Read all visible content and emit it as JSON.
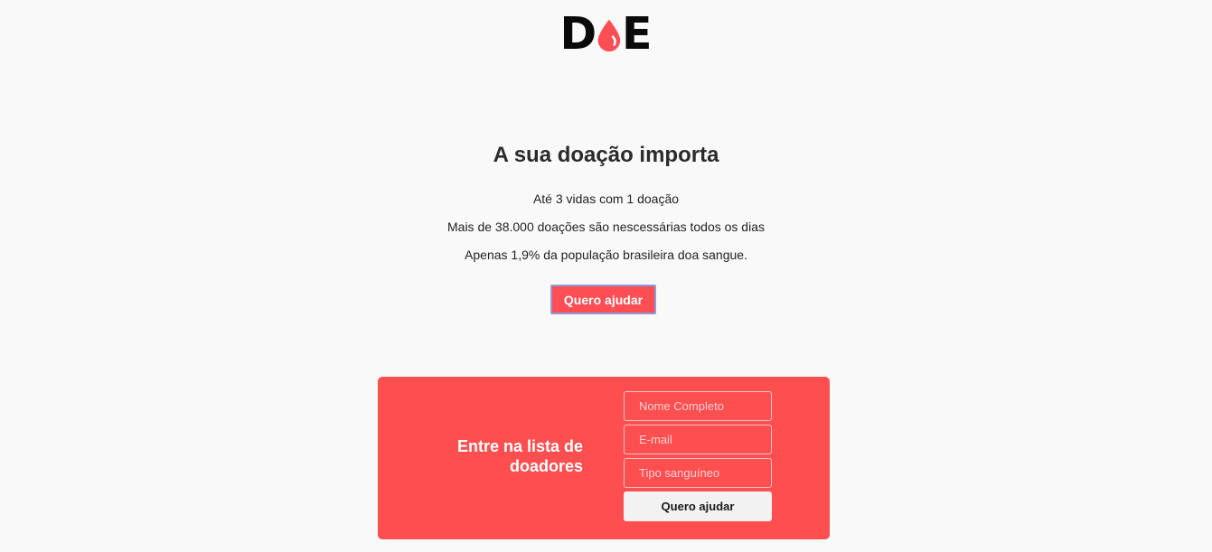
{
  "logo": {
    "letter_left": "D",
    "letter_right": "E",
    "drop_color": "#fd4e54"
  },
  "hero": {
    "title": "A sua doação importa",
    "lines": [
      "Até 3 vidas com 1 doação",
      "Mais de 38.000 doações são nescessárias todos os dias",
      "Apenas 1,9% da população brasileira doa sangue."
    ],
    "button_label": "Quero ajudar"
  },
  "donor_form": {
    "title": "Entre na lista de doadores",
    "name_placeholder": "Nome Completo",
    "email_placeholder": "E-mail",
    "blood_type_placeholder": "Tipo sanguíneo",
    "submit_label": "Quero ajudar"
  },
  "colors": {
    "accent": "#fd4e50",
    "background": "#f9f9f9"
  }
}
